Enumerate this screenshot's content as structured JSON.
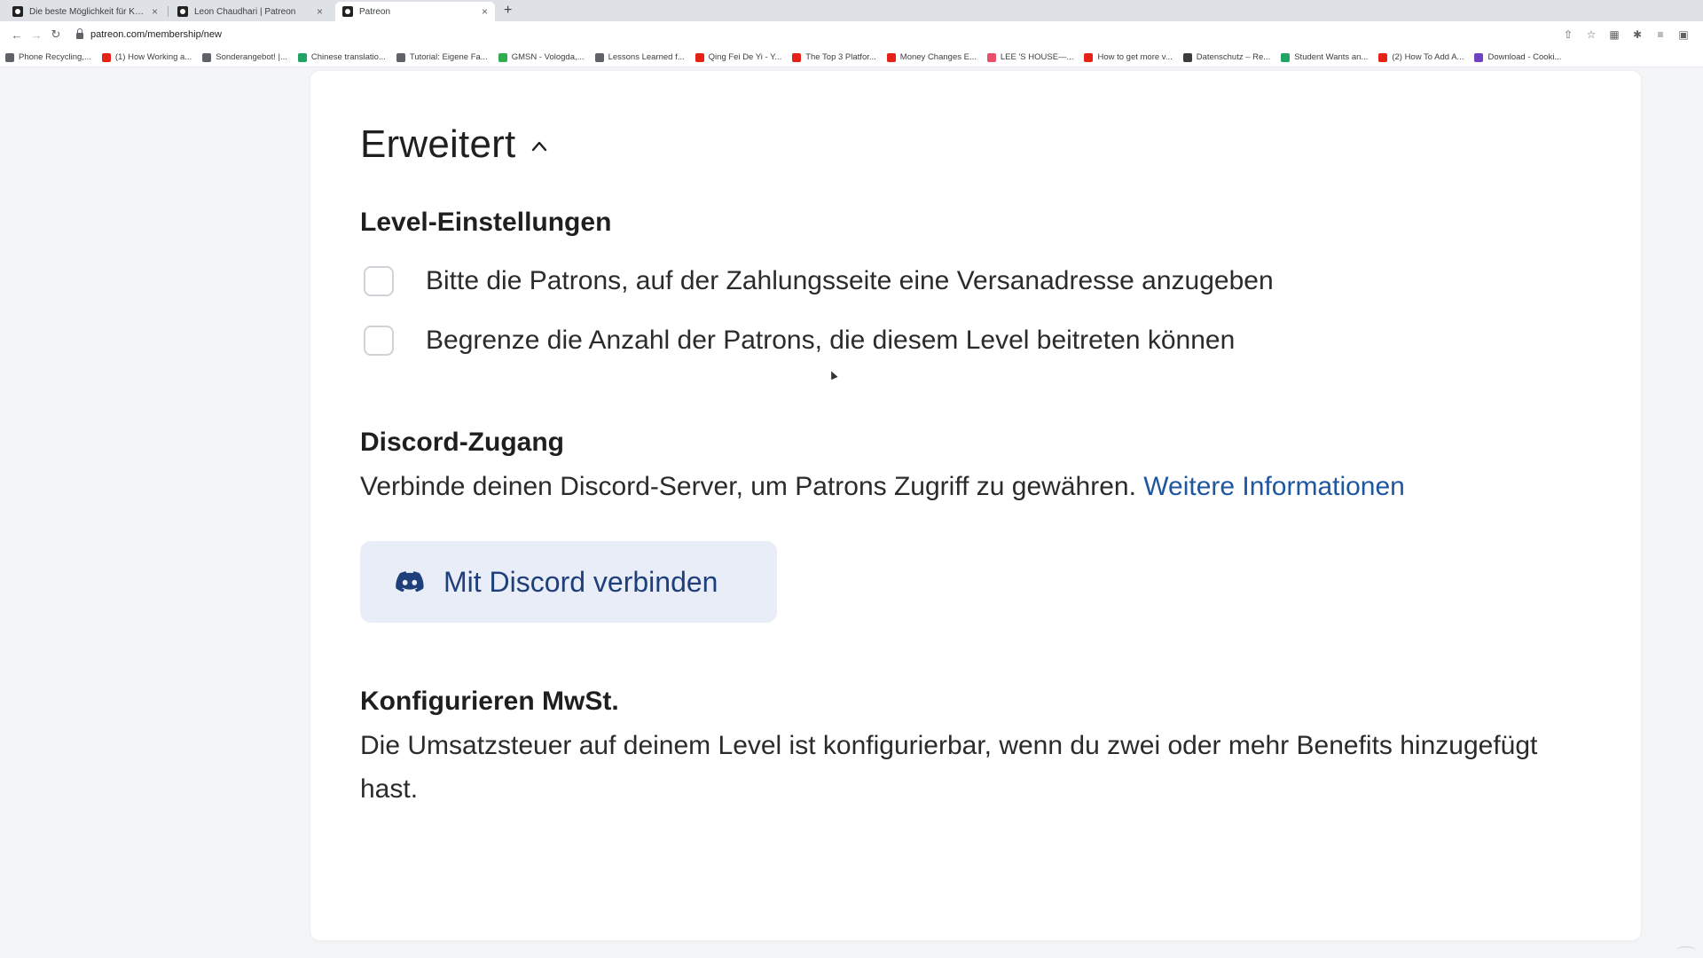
{
  "browser": {
    "tabs": [
      {
        "label": "Die beste Möglichkeit für Küns",
        "active": false
      },
      {
        "label": "Leon Chaudhari | Patreon",
        "active": false
      },
      {
        "label": "Patreon",
        "active": true
      }
    ],
    "new_tab_symbol": "+",
    "tab_close_symbol": "×",
    "url": "patreon.com/membership/new",
    "bookmarks": [
      {
        "label": "Phone Recycling,...",
        "icon_color": "#5f6368"
      },
      {
        "label": "(1) How Working a...",
        "icon_color": "#e62117"
      },
      {
        "label": "Sonderangebot! |...",
        "icon_color": "#5f6368"
      },
      {
        "label": "Chinese translatio...",
        "icon_color": "#1fa463"
      },
      {
        "label": "Tutorial: Eigene Fa...",
        "icon_color": "#5f6368"
      },
      {
        "label": "GMSN - Vologda,...",
        "icon_color": "#2eae4e"
      },
      {
        "label": "Lessons Learned f...",
        "icon_color": "#5f6368"
      },
      {
        "label": "Qing Fei De Yi - Y...",
        "icon_color": "#e62117"
      },
      {
        "label": "The Top 3 Platfor...",
        "icon_color": "#e62117"
      },
      {
        "label": "Money Changes E...",
        "icon_color": "#e62117"
      },
      {
        "label": "LEE 'S HOUSE—...",
        "icon_color": "#e94f6b"
      },
      {
        "label": "How to get more v...",
        "icon_color": "#e62117"
      },
      {
        "label": "Datenschutz – Re...",
        "icon_color": "#3c3c3c"
      },
      {
        "label": "Student Wants an...",
        "icon_color": "#1fa463"
      },
      {
        "label": "(2) How To Add A...",
        "icon_color": "#e62117"
      },
      {
        "label": "Download - Cooki...",
        "icon_color": "#6f42c1"
      }
    ]
  },
  "section": {
    "title": "Erweitert"
  },
  "level_settings": {
    "title": "Level-Einstellungen",
    "options": [
      {
        "label": "Bitte die Patrons, auf der Zahlungsseite eine Versanadresse anzugeben",
        "checked": false
      },
      {
        "label": "Begrenze die Anzahl der Patrons, die diesem Level beitreten können",
        "checked": false
      }
    ]
  },
  "discord": {
    "title": "Discord-Zugang",
    "description": "Verbinde deinen Discord-Server, um Patrons Zugriff zu gewähren.",
    "link_label": "Weitere Informationen",
    "button_label": "Mit Discord verbinden",
    "brand_color": "#1e3f7a"
  },
  "vat": {
    "title": "Konfigurieren MwSt.",
    "description": "Die Umsatzsteuer auf deinem Level ist konfigurierbar, wenn du zwei oder mehr Benefits hinzugefügt hast."
  },
  "colors": {
    "link": "#1e56a0",
    "button_bg": "#e9edf7",
    "page_bg": "#f4f5f7"
  }
}
